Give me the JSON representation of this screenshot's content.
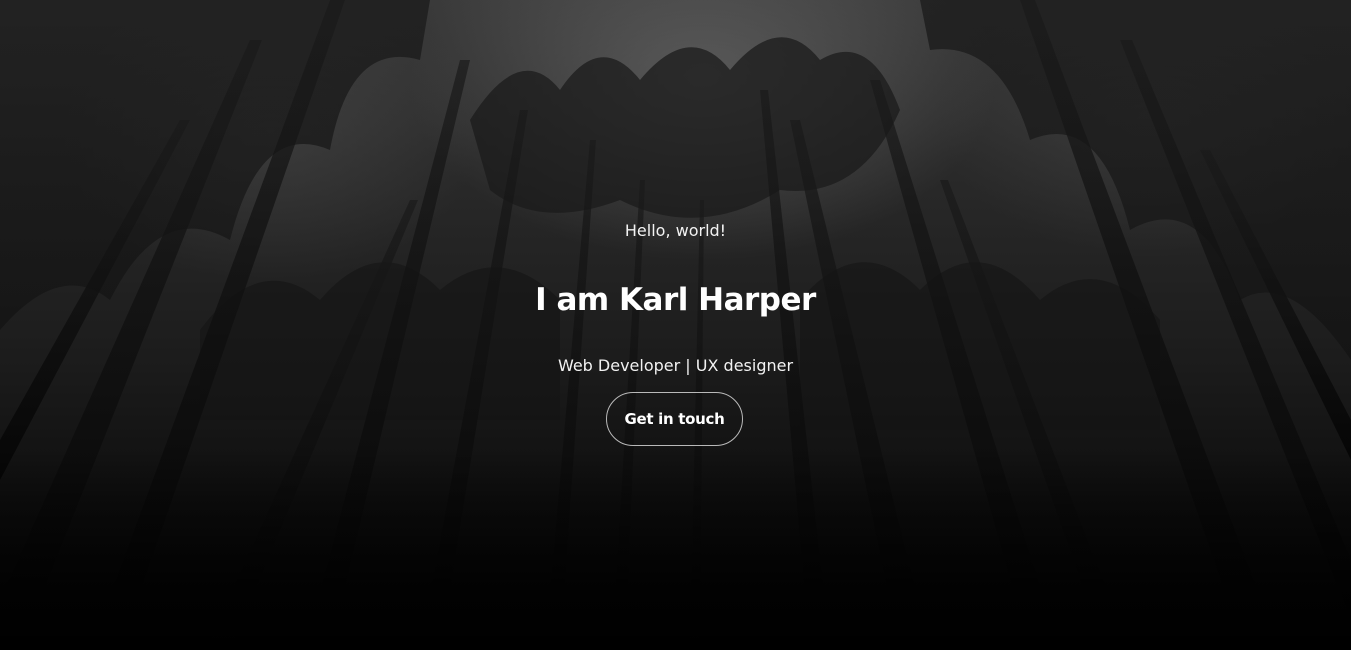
{
  "hero": {
    "greeting": "Hello, world!",
    "headline": "I am Karl Harper",
    "roles": "Web Developer | UX designer",
    "cta_label": "Get in touch"
  },
  "colors": {
    "text": "#ffffff",
    "button_border": "#bfbfbf",
    "background_top": "#3a3a3a",
    "background_bottom": "#040404"
  }
}
